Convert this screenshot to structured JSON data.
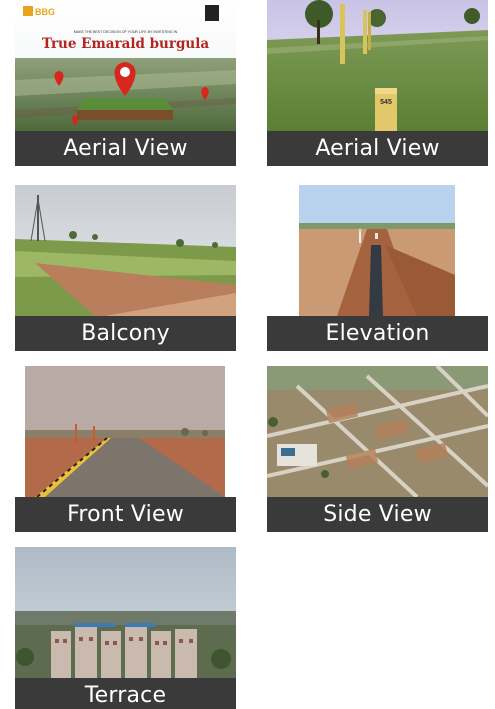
{
  "gallery": {
    "tiles": [
      {
        "caption": "Aerial View",
        "photo": "brochure-aerial-image"
      },
      {
        "caption": "Aerial View",
        "photo": "field-boundary-stone-image"
      },
      {
        "caption": "Balcony",
        "photo": "open-plot-land-image"
      },
      {
        "caption": "Elevation",
        "photo": "pipeline-trench-image"
      },
      {
        "caption": "Front View",
        "photo": "entrance-road-image"
      },
      {
        "caption": "Side View",
        "photo": "layout-drone-image"
      },
      {
        "caption": "Terrace",
        "photo": "city-buildings-image"
      }
    ]
  },
  "brochure": {
    "brand": "BBG",
    "tagline": "MAKE THE BEST DECISION OF YOUR LIFE BY INVESTING IN",
    "title": "True Emarald burgula"
  },
  "plot_marker": {
    "number": "545"
  },
  "colors": {
    "caption_bg": "#3a3a3a",
    "caption_text": "#ffffff",
    "brand_accent": "#e8a51c",
    "title_red": "#b3261e"
  }
}
